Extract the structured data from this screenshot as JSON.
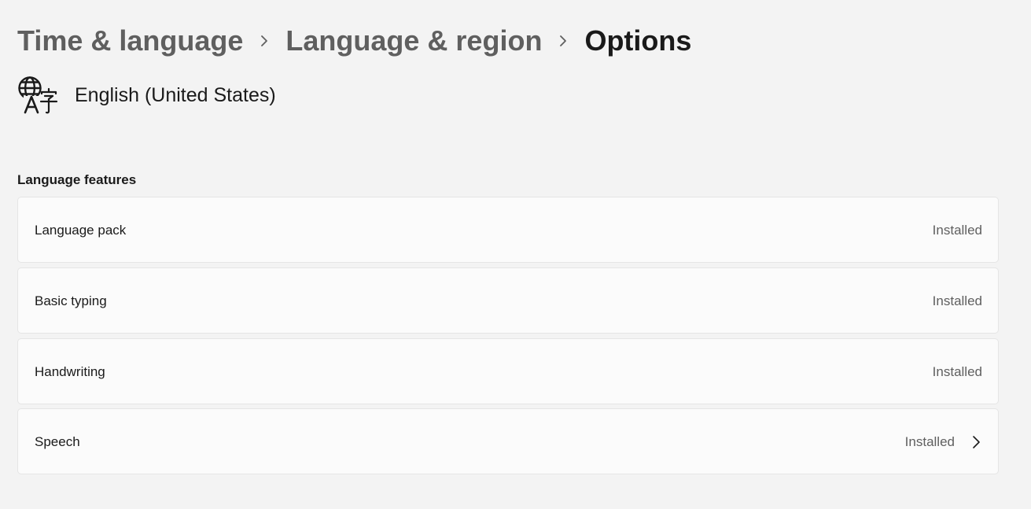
{
  "breadcrumb": {
    "items": [
      "Time & language",
      "Language & region"
    ],
    "current": "Options"
  },
  "language": {
    "name": "English (United States)",
    "icon": "language-icon"
  },
  "features": {
    "heading": "Language features",
    "items": [
      {
        "label": "Language pack",
        "status": "Installed"
      },
      {
        "label": "Basic typing",
        "status": "Installed"
      },
      {
        "label": "Handwriting",
        "status": "Installed"
      },
      {
        "label": "Speech",
        "status": "Installed"
      }
    ]
  },
  "colors": {
    "background": "#f3f3f3",
    "card": "#fbfbfb",
    "card_border": "#e5e5e5",
    "text_primary": "#1a1a1a",
    "text_secondary": "#5f5f5f"
  }
}
